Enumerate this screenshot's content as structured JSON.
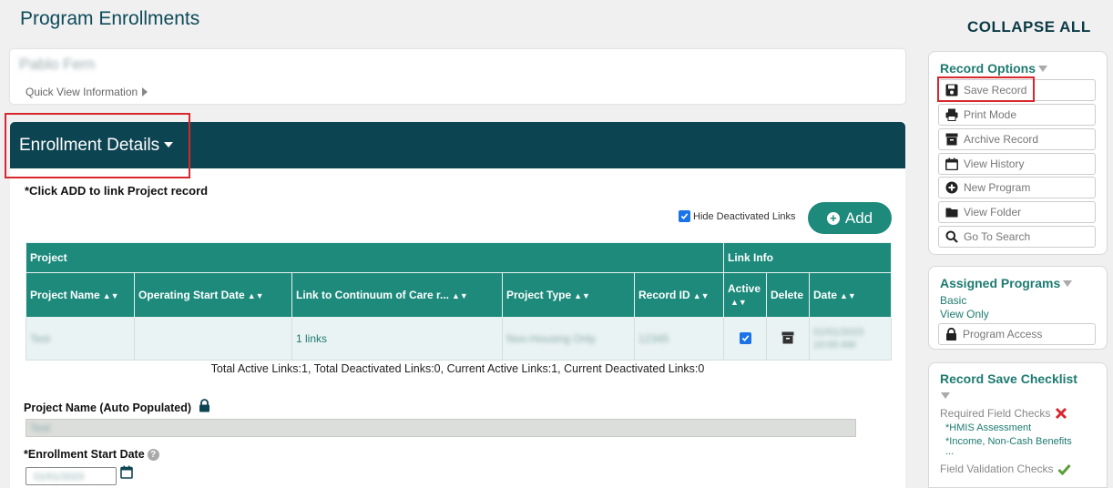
{
  "page": {
    "title": "Program Enrollments",
    "collapse_all": "COLLAPSE ALL"
  },
  "client": {
    "name": "Pablo Fern",
    "quick_view": "Quick View Information"
  },
  "enrollment": {
    "title": "Enrollment Details",
    "instruction": "*Click ADD to link Project record",
    "hide_deactivated_label": "Hide Deactivated Links",
    "hide_deactivated_checked": true,
    "add_label": "Add",
    "table": {
      "group_headers": {
        "project": "Project",
        "link_info": "Link Info"
      },
      "columns": [
        "Project Name",
        "Operating Start Date",
        "Link to Continuum of Care r...",
        "Project Type",
        "Record ID",
        "Active",
        "Delete",
        "Date"
      ],
      "rows": [
        {
          "project_name": "Test",
          "operating_start_date": "",
          "link_coc": "1 links",
          "project_type": "Non-Housing Only",
          "record_id": "12345",
          "active": true,
          "date": "01/01/2023 10:00 AM"
        }
      ]
    },
    "totals": "Total Active Links:1, Total Deactivated Links:0, Current Active Links:1, Current Deactivated Links:0",
    "project_name_label": "Project Name (Auto Populated)",
    "project_name_value": "Test",
    "start_date_label": "*Enrollment Start Date",
    "start_date_value": "01/01/2023"
  },
  "sidebar": {
    "record_options": {
      "title": "Record Options",
      "buttons": [
        {
          "label": "Save Record",
          "icon": "save-icon"
        },
        {
          "label": "Print Mode",
          "icon": "printer-icon"
        },
        {
          "label": "Archive Record",
          "icon": "archive-icon"
        },
        {
          "label": "View History",
          "icon": "calendar-icon"
        },
        {
          "label": "New Program",
          "icon": "plus-circle-icon"
        },
        {
          "label": "View Folder",
          "icon": "folder-icon"
        },
        {
          "label": "Go To Search",
          "icon": "search-icon"
        }
      ]
    },
    "assigned_programs": {
      "title": "Assigned Programs",
      "lines": [
        "Basic",
        "View Only"
      ],
      "access_button": "Program Access"
    },
    "checklist": {
      "title": "Record Save Checklist",
      "required_label": "Required Field Checks",
      "items": [
        "*HMIS Assessment",
        "*Income, Non-Cash Benefits",
        "..."
      ],
      "validation_label": "Field Validation Checks"
    }
  },
  "colors": {
    "header_bg": "#0d4452",
    "accent": "#1d8a7c",
    "highlight": "#d9272e",
    "fail": "#d9272e",
    "pass": "#5a9e3a"
  }
}
